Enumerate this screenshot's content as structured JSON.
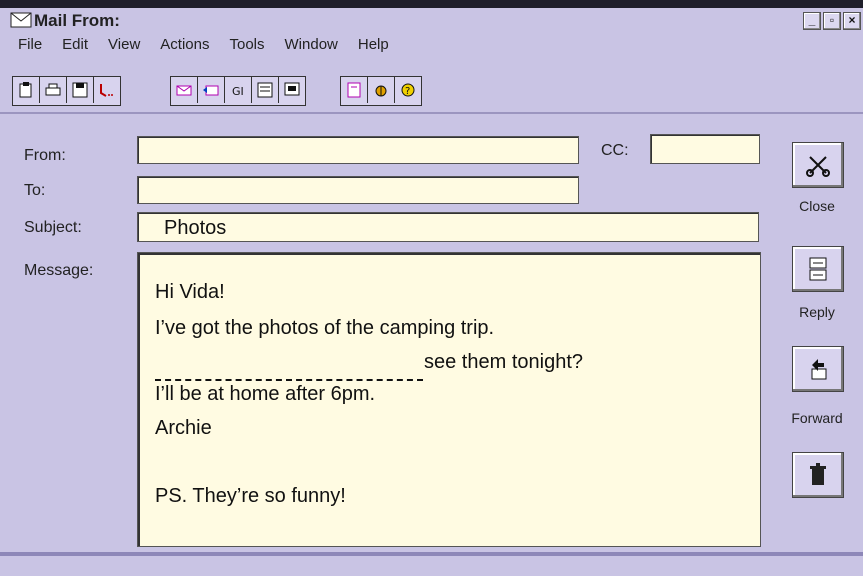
{
  "window": {
    "title": "Mail From:"
  },
  "window_buttons": {
    "minimize": "_",
    "maximize": "▫",
    "close": "×"
  },
  "menu": [
    "File",
    "Edit",
    "View",
    "Actions",
    "Tools",
    "Window",
    "Help"
  ],
  "toolbar": {
    "group1": [
      "new-icon",
      "print-icon",
      "save-icon",
      "voice-icon"
    ],
    "group2": [
      "send-icon",
      "receive-icon",
      "address-icon",
      "attach-icon",
      "window-icon"
    ],
    "group3": [
      "book-icon",
      "bug-icon",
      "help-icon"
    ]
  },
  "form": {
    "from_label": "From:",
    "to_label": "To:",
    "cc_label": "CC:",
    "subject_label": "Subject:",
    "message_label": "Message:",
    "from_value": "",
    "to_value": "",
    "cc_value": "",
    "subject_value": "Photos"
  },
  "message": {
    "line1": "Hi Vida!",
    "line2": "I’ve got the photos of the camping trip.",
    "line3": "see them tonight?",
    "line4": "I’ll be at home after 6pm.",
    "line5": "Archie",
    "line6": "PS.   They’re so funny!"
  },
  "side_buttons": {
    "close_label": "Close",
    "reply_label": "Reply",
    "forward_label": "Forward"
  },
  "colors": {
    "background": "#c9c4e4",
    "field": "#fffbe2"
  }
}
